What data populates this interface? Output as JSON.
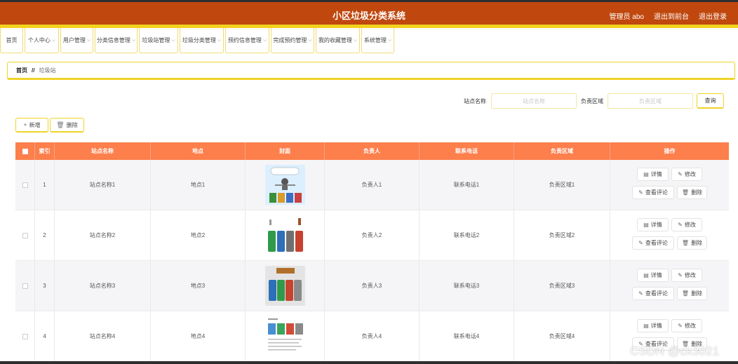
{
  "app": {
    "title": "小区垃圾分类系统"
  },
  "header": {
    "user_label": "管理员 abo",
    "front_link": "退出到前台",
    "logout_link": "退出登录"
  },
  "menu": [
    {
      "label": "首页",
      "has_chevron": false
    },
    {
      "label": "个人中心",
      "has_chevron": true
    },
    {
      "label": "用户管理",
      "has_chevron": true
    },
    {
      "label": "分类信息管理",
      "has_chevron": true
    },
    {
      "label": "垃圾站管理",
      "has_chevron": true
    },
    {
      "label": "垃圾分类管理",
      "has_chevron": true
    },
    {
      "label": "预约信息管理",
      "has_chevron": true
    },
    {
      "label": "完成预约管理",
      "has_chevron": true
    },
    {
      "label": "我的收藏管理",
      "has_chevron": true
    },
    {
      "label": "系统管理",
      "has_chevron": true
    }
  ],
  "breadcrumb": {
    "home": "首页",
    "separator": "//",
    "current": "垃圾站"
  },
  "search": {
    "station_label": "站点名称",
    "station_placeholder": "站点名称",
    "area_label": "负责区域",
    "area_placeholder": "负责区域",
    "query_button": "查询"
  },
  "toolbar": {
    "add_label": "新增",
    "delete_label": "删除"
  },
  "table": {
    "columns": [
      "",
      "索引",
      "站点名称",
      "地点",
      "封面",
      "负责人",
      "联系电话",
      "负责区域",
      "操作"
    ],
    "rows": [
      {
        "index": "1",
        "name": "站点名称1",
        "location": "地点1",
        "cover": "cover-sorting-bins-poster",
        "manager": "负责人1",
        "phone": "联系电话1",
        "area": "负责区域1"
      },
      {
        "index": "2",
        "name": "站点名称2",
        "location": "地点2",
        "cover": "cover-four-color-bins",
        "manager": "负责人2",
        "phone": "联系电话2",
        "area": "负责区域2"
      },
      {
        "index": "3",
        "name": "站点名称3",
        "location": "地点3",
        "cover": "cover-bins-with-sign",
        "manager": "负责人3",
        "phone": "联系电话3",
        "area": "负责区域3"
      },
      {
        "index": "4",
        "name": "站点名称4",
        "location": "地点4",
        "cover": "cover-sorting-guide",
        "manager": "负责人4",
        "phone": "联系电话4",
        "area": "负责区域4"
      }
    ],
    "actions": {
      "detail": "详情",
      "edit": "修改",
      "comments": "查看评论",
      "delete": "删除"
    }
  },
  "watermark": "CSDN @ck3021",
  "colors": {
    "header_bg": "#c0480e",
    "accent_yellow": "#f0d327",
    "table_header_bg": "#fd7f4c"
  }
}
